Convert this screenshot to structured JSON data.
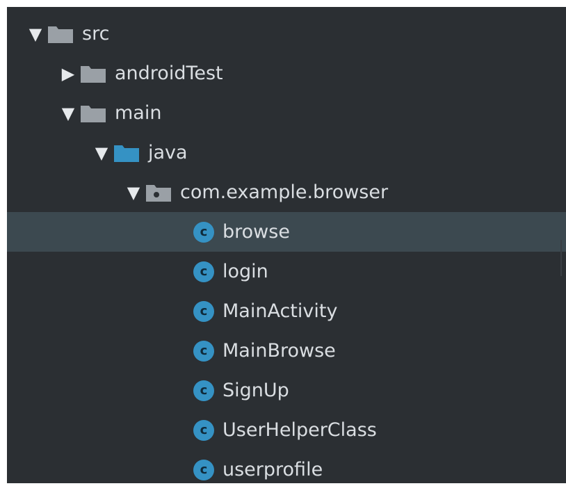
{
  "tree": {
    "src": {
      "label": "src",
      "arrow": "▼",
      "icon": "folder-icon"
    },
    "androidTest": {
      "label": "androidTest",
      "arrow": "▶",
      "icon": "folder-icon"
    },
    "main": {
      "label": "main",
      "arrow": "▼",
      "icon": "folder-icon"
    },
    "java": {
      "label": "java",
      "arrow": "▼",
      "icon": "source-folder-icon"
    },
    "package": {
      "label": "com.example.browser",
      "arrow": "▼",
      "icon": "package-icon"
    },
    "classes": [
      {
        "label": "browse",
        "icon_letter": "c",
        "selected": true
      },
      {
        "label": "login",
        "icon_letter": "c"
      },
      {
        "label": "MainActivity",
        "icon_letter": "c"
      },
      {
        "label": "MainBrowse",
        "icon_letter": "c"
      },
      {
        "label": "SignUp",
        "icon_letter": "c"
      },
      {
        "label": "UserHelperClass",
        "icon_letter": "c"
      },
      {
        "label": "userprofile",
        "icon_letter": "c"
      }
    ]
  },
  "colors": {
    "background": "#2b2f33",
    "selection": "#3c4950",
    "text": "#dadee2",
    "folder": "#9aa0a6",
    "source_folder": "#3592c4",
    "class_icon": "#3592c4"
  }
}
